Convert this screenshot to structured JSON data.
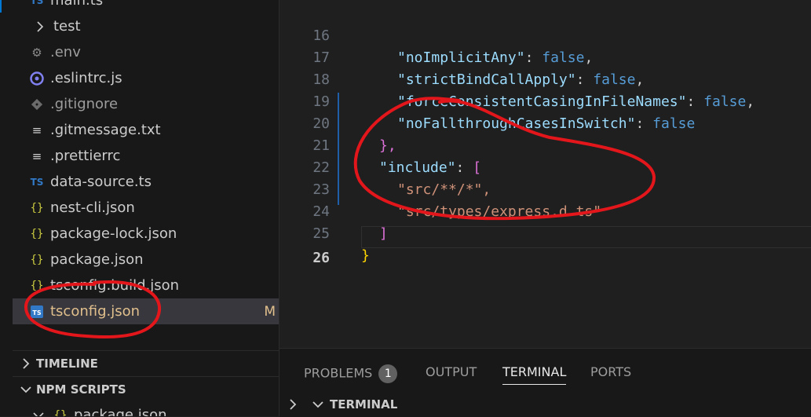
{
  "explorer": {
    "items": [
      {
        "label": "main.ts",
        "icon": "ts-icon"
      },
      {
        "label": "test",
        "icon": "chevron-right-icon"
      },
      {
        "label": ".env",
        "icon": "gear-icon"
      },
      {
        "label": ".eslintrc.js",
        "icon": "eslint-icon"
      },
      {
        "label": ".gitignore",
        "icon": "git-icon"
      },
      {
        "label": ".gitmessage.txt",
        "icon": "text-file-icon"
      },
      {
        "label": ".prettierrc",
        "icon": "text-file-icon"
      },
      {
        "label": "data-source.ts",
        "icon": "ts-icon"
      },
      {
        "label": "nest-cli.json",
        "icon": "json-icon"
      },
      {
        "label": "package-lock.json",
        "icon": "json-icon"
      },
      {
        "label": "package.json",
        "icon": "json-icon"
      },
      {
        "label": "tsconfig.build.json",
        "icon": "json-icon"
      },
      {
        "label": "tsconfig.json",
        "icon": "tsconfig-icon",
        "badge": "M"
      }
    ],
    "timeline_label": "TIMELINE",
    "npm_scripts_label": "NPM SCRIPTS",
    "npm_item": "package.json"
  },
  "editor": {
    "lines": [
      {
        "num": "16",
        "key": "noImplicitAny",
        "value": "false"
      },
      {
        "num": "17",
        "key": "strictBindCallApply",
        "value": "false"
      },
      {
        "num": "18",
        "key": "forceConsistentCasingInFileNames",
        "value": "false"
      },
      {
        "num": "19",
        "key": "noFallthroughCasesInSwitch",
        "value": "false"
      },
      {
        "num": "20",
        "text": "},"
      },
      {
        "num": "21",
        "key": "include",
        "open": "["
      },
      {
        "num": "22",
        "str": "src/**/*"
      },
      {
        "num": "23",
        "str": "src/types/express.d.ts"
      },
      {
        "num": "24",
        "close": "]"
      },
      {
        "num": "25",
        "brace": "}"
      },
      {
        "num": "26"
      }
    ]
  },
  "panel": {
    "tabs": [
      "PROBLEMS",
      "OUTPUT",
      "TERMINAL",
      "PORTS"
    ],
    "problems_count": "1",
    "active_tab": "TERMINAL",
    "terminal_header": "TERMINAL"
  },
  "colors": {
    "accent": "#0078d4",
    "annotation": "#e3161b",
    "modified": "#e2c08d"
  }
}
